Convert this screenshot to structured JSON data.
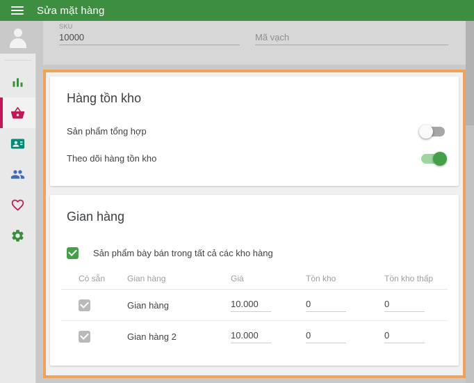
{
  "header": {
    "title": "Sửa mặt hàng"
  },
  "sidebar": {
    "items": [
      {
        "label": "reports",
        "icon": "bar-chart-icon",
        "active": false
      },
      {
        "label": "items",
        "icon": "basket-icon",
        "active": true
      },
      {
        "label": "employees",
        "icon": "id-card-icon",
        "active": false
      },
      {
        "label": "customers",
        "icon": "people-icon",
        "active": false
      },
      {
        "label": "favorites",
        "icon": "heart-icon",
        "active": false
      },
      {
        "label": "settings",
        "icon": "gear-icon",
        "active": false
      }
    ]
  },
  "top_form": {
    "sku_label": "SKU",
    "sku_value": "10000",
    "barcode_placeholder": "Mã vạch"
  },
  "inventory_section": {
    "title": "Hàng tồn kho",
    "toggles": [
      {
        "label": "Sản phẩm tổng hợp",
        "on": false
      },
      {
        "label": "Theo dõi hàng tồn kho",
        "on": true
      }
    ]
  },
  "store_section": {
    "title": "Gian hàng",
    "checkbox_label": "Sản phẩm bày bán trong tất cả các kho hàng",
    "checkbox_checked": true,
    "table": {
      "columns": [
        "Có sẵn",
        "Gian hàng",
        "Giá",
        "Tồn kho",
        "Tồn kho thấp"
      ],
      "rows": [
        {
          "available": true,
          "store": "Gian hàng",
          "price": "10.000",
          "stock": "0",
          "low_stock": "0"
        },
        {
          "available": true,
          "store": "Gian hàng 2",
          "price": "10.000",
          "stock": "0",
          "low_stock": "0"
        }
      ]
    }
  },
  "colors": {
    "header_green": "#3e8e41",
    "highlight_orange": "#f0a256",
    "toggle_on_green": "#43a047",
    "toggle_track_green": "#9ed4a0",
    "checkbox_green": "#43a047",
    "checkbox_disabled_gray": "#b9b9b9",
    "icon_green": "#388e3c",
    "icon_crimson": "#c2185b",
    "icon_teal": "#00897b",
    "icon_blue": "#3f6db5",
    "active_item_bar": "#c2185b"
  }
}
